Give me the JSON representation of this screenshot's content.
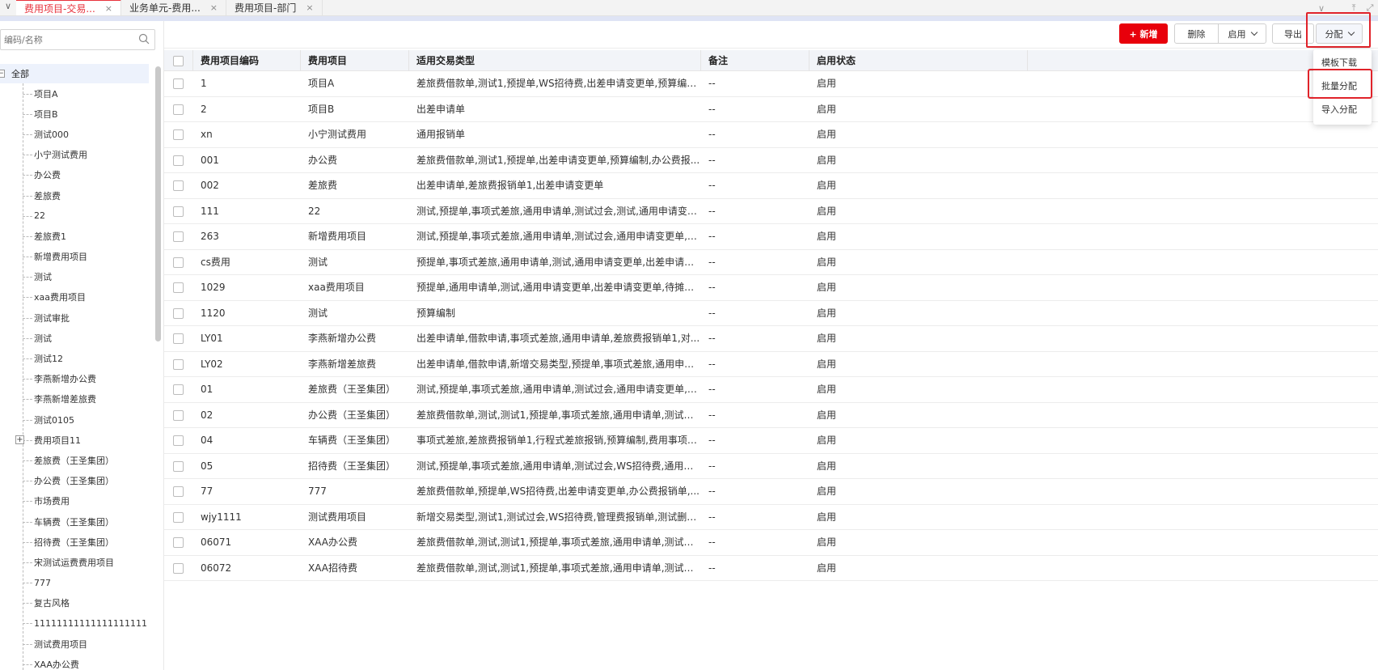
{
  "tabs": [
    {
      "label": "费用项目-交易...",
      "close": "×"
    },
    {
      "label": "业务单元-费用...",
      "close": "×"
    },
    {
      "label": "费用项目-部门",
      "close": "×"
    }
  ],
  "tabbar": {
    "back": "∨",
    "more": "∨",
    "upload": "⤒",
    "expand": "⤢"
  },
  "sidebar": {
    "search_placeholder": "编码/名称",
    "root_label": "全部",
    "root_toggle": "−",
    "plus": "+",
    "items": [
      "项目A",
      "项目B",
      "测试000",
      "小宁测试费用",
      "办公费",
      "差旅费",
      "22",
      "差旅费1",
      "新增费用项目",
      "测试",
      "xaa费用项目",
      "测试审批",
      "测试",
      "测试12",
      "李燕新增办公费",
      "李燕新增差旅费",
      "测试0105",
      "费用项目11",
      "差旅费（王圣集团）",
      "办公费（王圣集团）",
      "市场费用",
      "车辆费（王圣集团）",
      "招待费（王圣集团）",
      "宋测试运费费用项目",
      "777",
      "复古风格",
      "11111111111111111111",
      "测试费用项目",
      "XAA办公费"
    ]
  },
  "toolbar": {
    "add_label": "+ 新增",
    "delete_label": "删除",
    "enable_label": "启用",
    "export_label": "导出",
    "assign_label": "分配"
  },
  "dropdown": {
    "items": [
      "模板下载",
      "批量分配",
      "导入分配"
    ]
  },
  "table": {
    "headers": [
      "费用项目编码",
      "费用项目",
      "适用交易类型",
      "备注",
      "启用状态",
      ""
    ],
    "rows": [
      [
        "1",
        "项目A",
        "差旅费借款单,测试1,预提单,WS招待费,出差申请变更单,预算编制,...",
        "--",
        "启用"
      ],
      [
        "2",
        "项目B",
        "出差申请单",
        "--",
        "启用"
      ],
      [
        "xn",
        "小宁测试费用",
        "通用报销单",
        "--",
        "启用"
      ],
      [
        "001",
        "办公费",
        "差旅费借款单,测试1,预提单,出差申请变更单,预算编制,办公费报...",
        "--",
        "启用"
      ],
      [
        "002",
        "差旅费",
        "出差申请单,差旅费报销单1,出差申请变更单",
        "--",
        "启用"
      ],
      [
        "111",
        "22",
        "测试,预提单,事项式差旅,通用申请单,测试过会,测试,通用申请变更...",
        "--",
        "启用"
      ],
      [
        "263",
        "新增费用项目",
        "测试,预提单,事项式差旅,通用申请单,测试过会,通用申请变更单,出...",
        "--",
        "启用"
      ],
      [
        "cs费用",
        "测试",
        "预提单,事项式差旅,通用申请单,测试,通用申请变更单,出差申请变...",
        "--",
        "启用"
      ],
      [
        "1029",
        "xaa费用项目",
        "预提单,通用申请单,测试,通用申请变更单,出差申请变更单,待摊费...",
        "--",
        "启用"
      ],
      [
        "1120",
        "测试",
        "预算编制",
        "--",
        "启用"
      ],
      [
        "LY01",
        "李燕新增办公费",
        "出差申请单,借款申请,事项式差旅,通用申请单,差旅费报销单1,对...",
        "--",
        "启用"
      ],
      [
        "LY02",
        "李燕新增差旅费",
        "出差申请单,借款申请,新增交易类型,预提单,事项式差旅,通用申请...",
        "--",
        "启用"
      ],
      [
        "01",
        "差旅费（王圣集团）",
        "测试,预提单,事项式差旅,通用申请单,测试过会,通用申请变更单,出...",
        "--",
        "启用"
      ],
      [
        "02",
        "办公费（王圣集团）",
        "差旅费借款单,测试,测试1,预提单,事项式差旅,通用申请单,测试过...",
        "--",
        "启用"
      ],
      [
        "04",
        "车辆费（王圣集团）",
        "事项式差旅,差旅费报销单1,行程式差旅报销,预算编制,费用事项式...",
        "--",
        "启用"
      ],
      [
        "05",
        "招待费（王圣集团）",
        "测试,预提单,事项式差旅,通用申请单,测试过会,WS招待费,通用申...",
        "--",
        "启用"
      ],
      [
        "77",
        "777",
        "差旅费借款单,预提单,WS招待费,出差申请变更单,办公费报销单,...",
        "--",
        "启用"
      ],
      [
        "wjy1111",
        "测试费用项目",
        "新增交易类型,测试1,测试过会,WS招待费,管理费报销单,测试删除...",
        "--",
        "启用"
      ],
      [
        "06071",
        "XAA办公费",
        "差旅费借款单,测试,测试1,预提单,事项式差旅,通用申请单,测试过...",
        "--",
        "启用"
      ],
      [
        "06072",
        "XAA招待费",
        "差旅费借款单,测试,测试1,预提单,事项式差旅,通用申请单,测试过...",
        "--",
        "启用"
      ]
    ]
  },
  "colors": {
    "accent_red": "#e8000b",
    "highlight_red": "#e0232a",
    "active_tab": "#e8323c"
  }
}
